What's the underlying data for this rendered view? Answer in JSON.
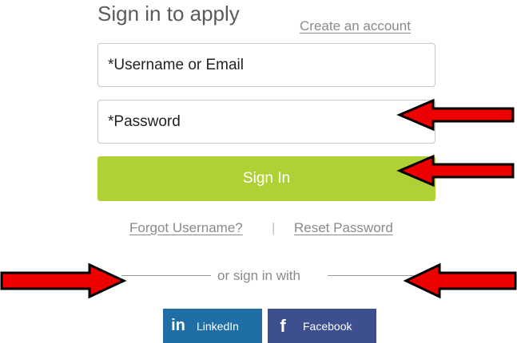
{
  "signin": {
    "heading": "Sign in to apply",
    "create_account": "Create an account",
    "username_placeholder": "*Username or Email",
    "password_placeholder": "*Password",
    "submit_label": "Sign In",
    "forgot_username": "Forgot Username?",
    "separator": "|",
    "reset_password": "Reset Password",
    "or_sign_in_with": "or sign in with"
  },
  "social": {
    "linkedin": {
      "icon": "linkedin-icon",
      "glyph": "in",
      "label": "LinkedIn",
      "color": "#1f6fa6"
    },
    "facebook": {
      "icon": "facebook-icon",
      "glyph": "f",
      "label": "Facebook",
      "color": "#3d4f8f"
    }
  },
  "colors": {
    "accent_green": "#b0d136",
    "annotation_arrow": "#ee0000"
  }
}
